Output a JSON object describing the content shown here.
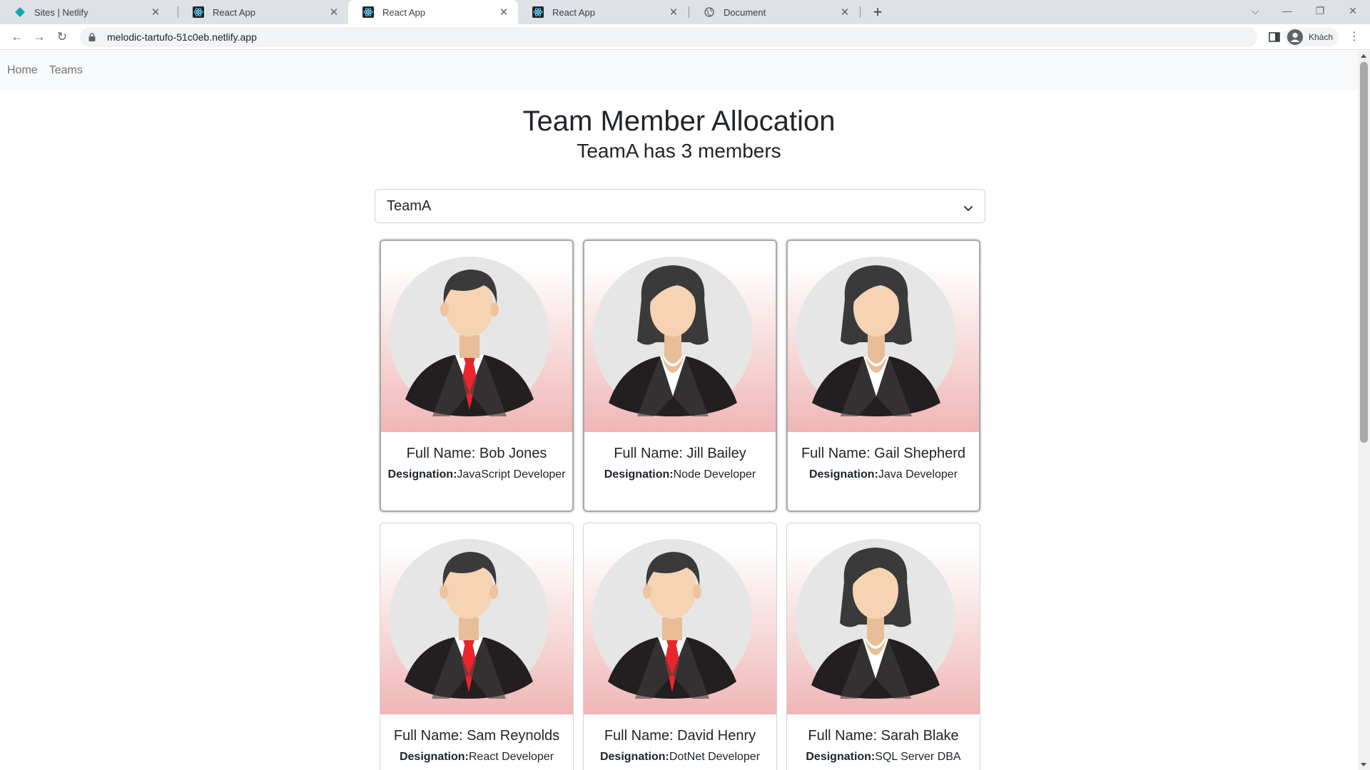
{
  "browser": {
    "tabs": [
      {
        "title": "Sites | Netlify",
        "favicon": "netlify-icon",
        "active": false
      },
      {
        "title": "React App",
        "favicon": "react-icon",
        "active": false
      },
      {
        "title": "React App",
        "favicon": "react-icon",
        "active": true
      },
      {
        "title": "React App",
        "favicon": "react-icon",
        "active": false
      },
      {
        "title": "Document",
        "favicon": "globe-icon",
        "active": false
      }
    ],
    "url": "melodic-tartufo-51c0eb.netlify.app",
    "profile_label": "Khách"
  },
  "nav": {
    "home": "Home",
    "teams": "Teams"
  },
  "header": {
    "title": "Team Member Allocation",
    "subtitle": "TeamA has 3 members"
  },
  "team_select": {
    "selected": "TeamA"
  },
  "designation_label": "Designation:",
  "employees": [
    {
      "fullName": "Full Name: Bob Jones",
      "designation": "JavaScript Developer",
      "gender": "male",
      "selected": true
    },
    {
      "fullName": "Full Name: Jill Bailey",
      "designation": "Node Developer",
      "gender": "female",
      "selected": true
    },
    {
      "fullName": "Full Name: Gail Shepherd",
      "designation": "Java Developer",
      "gender": "female",
      "selected": true
    },
    {
      "fullName": "Full Name: Sam Reynolds",
      "designation": "React Developer",
      "gender": "male",
      "selected": false
    },
    {
      "fullName": "Full Name: David Henry",
      "designation": "DotNet Developer",
      "gender": "male",
      "selected": false
    },
    {
      "fullName": "Full Name: Sarah Blake",
      "designation": "SQL Server DBA",
      "gender": "female",
      "selected": false
    }
  ],
  "colors": {
    "card_gradient_bottom": "#f0b6b6",
    "tie": "#e8262c",
    "suit": "#231f20",
    "skin": "#f5d3b3",
    "hair": "#3a3a3a"
  }
}
